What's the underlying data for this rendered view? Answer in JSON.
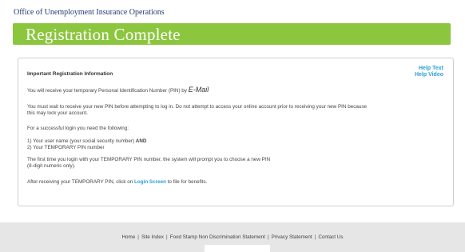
{
  "header": {
    "agency": "Office of Unemployment Insurance Operations",
    "banner_title": "Registration Complete"
  },
  "panel": {
    "heading": "Important Registration Information",
    "help_text": "Help Text",
    "help_video": "Help Video",
    "pin_intro": "You will receive your temporary Personal Identification Number (PIN) by",
    "pin_method": "E-Mail",
    "wait_line1": "You must wait to receive your new PIN before attempting to log in. Do not attempt to access your online account prior to receiving your new PIN because",
    "wait_line2": "this may lock your account.",
    "need_intro": "For a successful login you need the following:",
    "need_item1": "1) Your user name (your social security number)",
    "need_item1_and": "AND",
    "need_item2": "2) Your TEMPORARY PIN number",
    "first_line1": "The first time you login with your TEMPORARY PIN number, the system will prompt you to choose a new PIN",
    "first_line2": "(8-digit numeric only).",
    "after_pre": "After receiving your TEMPORARY PIN, click on",
    "after_link": "Login Screen",
    "after_post": "to file for benefits."
  },
  "footer": {
    "links": [
      "Home",
      "Site Index",
      "Food Stamp Non Discrimination Statement",
      "Privacy Statement",
      "Contact Us"
    ],
    "separator": "|"
  },
  "colors": {
    "banner": "#8cc63f",
    "link": "#2b9fd9",
    "agency_text": "#1f3a70",
    "footer_bg": "#e6e6e6"
  }
}
